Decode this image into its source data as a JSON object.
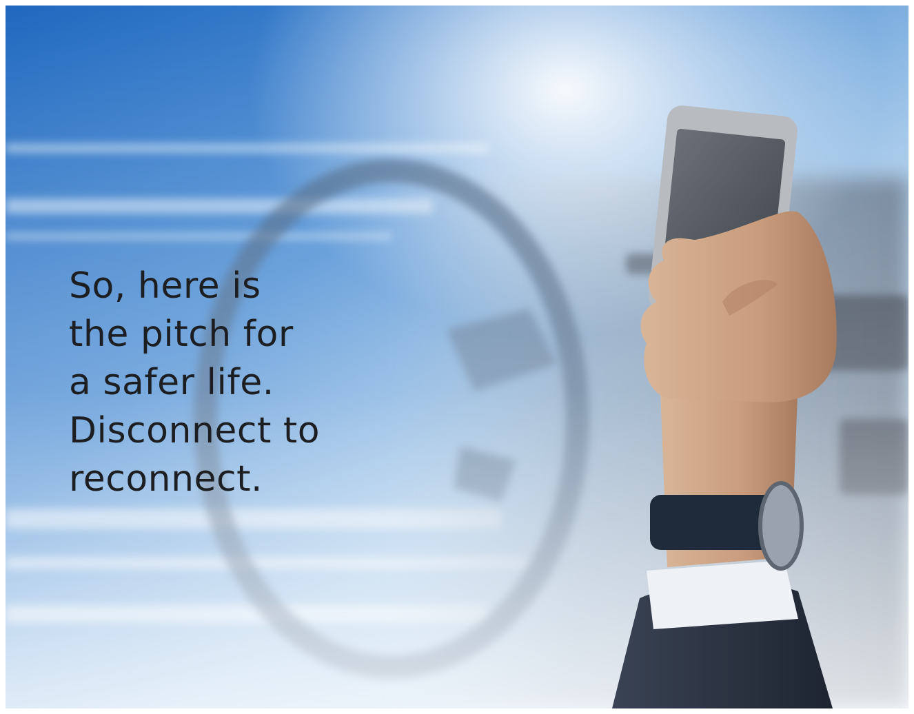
{
  "headline": {
    "lines": [
      "So, here is",
      "the pitch for",
      "a safer life.",
      "Disconnect to",
      "reconnect."
    ]
  },
  "photo": {
    "subject": "hand holding smartphone while driving",
    "icon": "phone-in-hand",
    "colors": {
      "sky_blue": "#2f79c9",
      "light_blue": "#9cc6ea",
      "haze": "#e8eef4",
      "phone_body": "#b8bcc1",
      "phone_screen": "#5a5f66",
      "skin": "#c9a183",
      "watch_strap": "#1f2a3a",
      "suit": "#2a3140",
      "shirt_cuff": "#eef1f6"
    }
  }
}
